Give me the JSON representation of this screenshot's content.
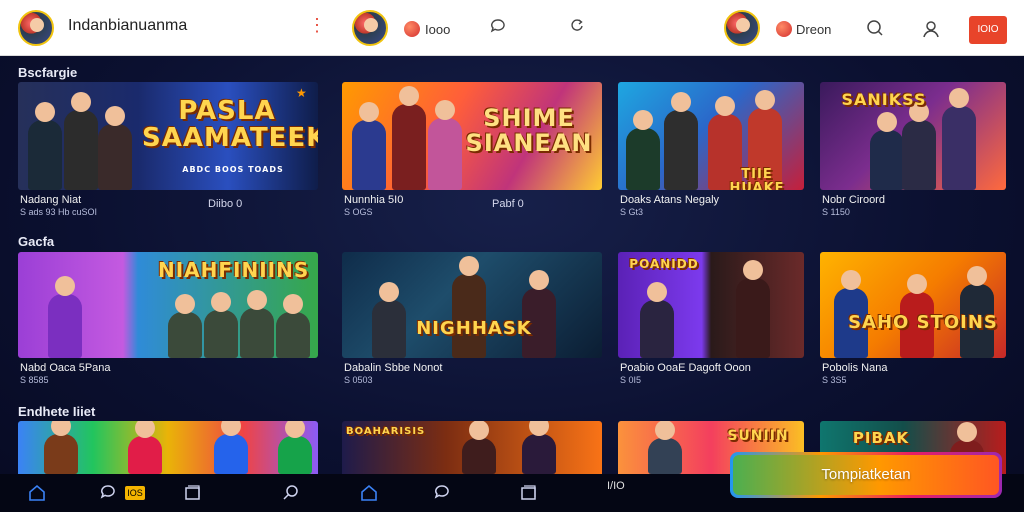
{
  "header": {
    "app_title": "Indanbianuanma",
    "label_1": "Iooo",
    "label_2": "Dreon",
    "badge": "IOIO"
  },
  "sections": [
    {
      "title": "Bscfargie",
      "cards": [
        {
          "banner": "PASLA SAAMATEEK",
          "caption": "ABDC BOOS TOADS",
          "name": "Nadang Niat",
          "meta": "S ads 93 Hb cuSOI",
          "side": "Diibo 0"
        },
        {
          "banner": "SHIME SIANEAN",
          "name": "Nunnhia 5I0",
          "meta": "S OGS",
          "side": "Pabf 0"
        },
        {
          "banner": "TIIE HUAKE",
          "name": "Doaks Atans Negaly",
          "meta": "S Gt3"
        },
        {
          "banner": "SANIKSS",
          "name": "Nobr Ciroord",
          "meta": "S 1150"
        }
      ]
    },
    {
      "title": "Gacfa",
      "cards": [
        {
          "banner": "NIAHFINIINS",
          "name": "Nabd Oaca 5Pana",
          "meta": "S 8585"
        },
        {
          "banner": "NIGHHASK",
          "name": "Dabalin Sbbe Nonot",
          "meta": "S 0503"
        },
        {
          "banner": "POANIDD",
          "name": "Poabio OoaE Dagoft Ooon",
          "meta": "S 0I5"
        },
        {
          "banner": "SAHO STOINS",
          "name": "Pobolis Nana",
          "meta": "S 3S5"
        }
      ]
    },
    {
      "title": "Endhete Iiiet",
      "cards": [
        {},
        {
          "banner": "BOAHARISIS"
        },
        {
          "banner": "SUNIIN"
        },
        {
          "banner": "PIBAK"
        }
      ]
    }
  ],
  "bottom_nav": {
    "badge": "IOS",
    "text": "I/IO",
    "cta_label": "Tompiatketan"
  },
  "colors": {
    "accent": "#e8442a",
    "nav_active": "#3b82f6",
    "background": "#0b1030"
  }
}
